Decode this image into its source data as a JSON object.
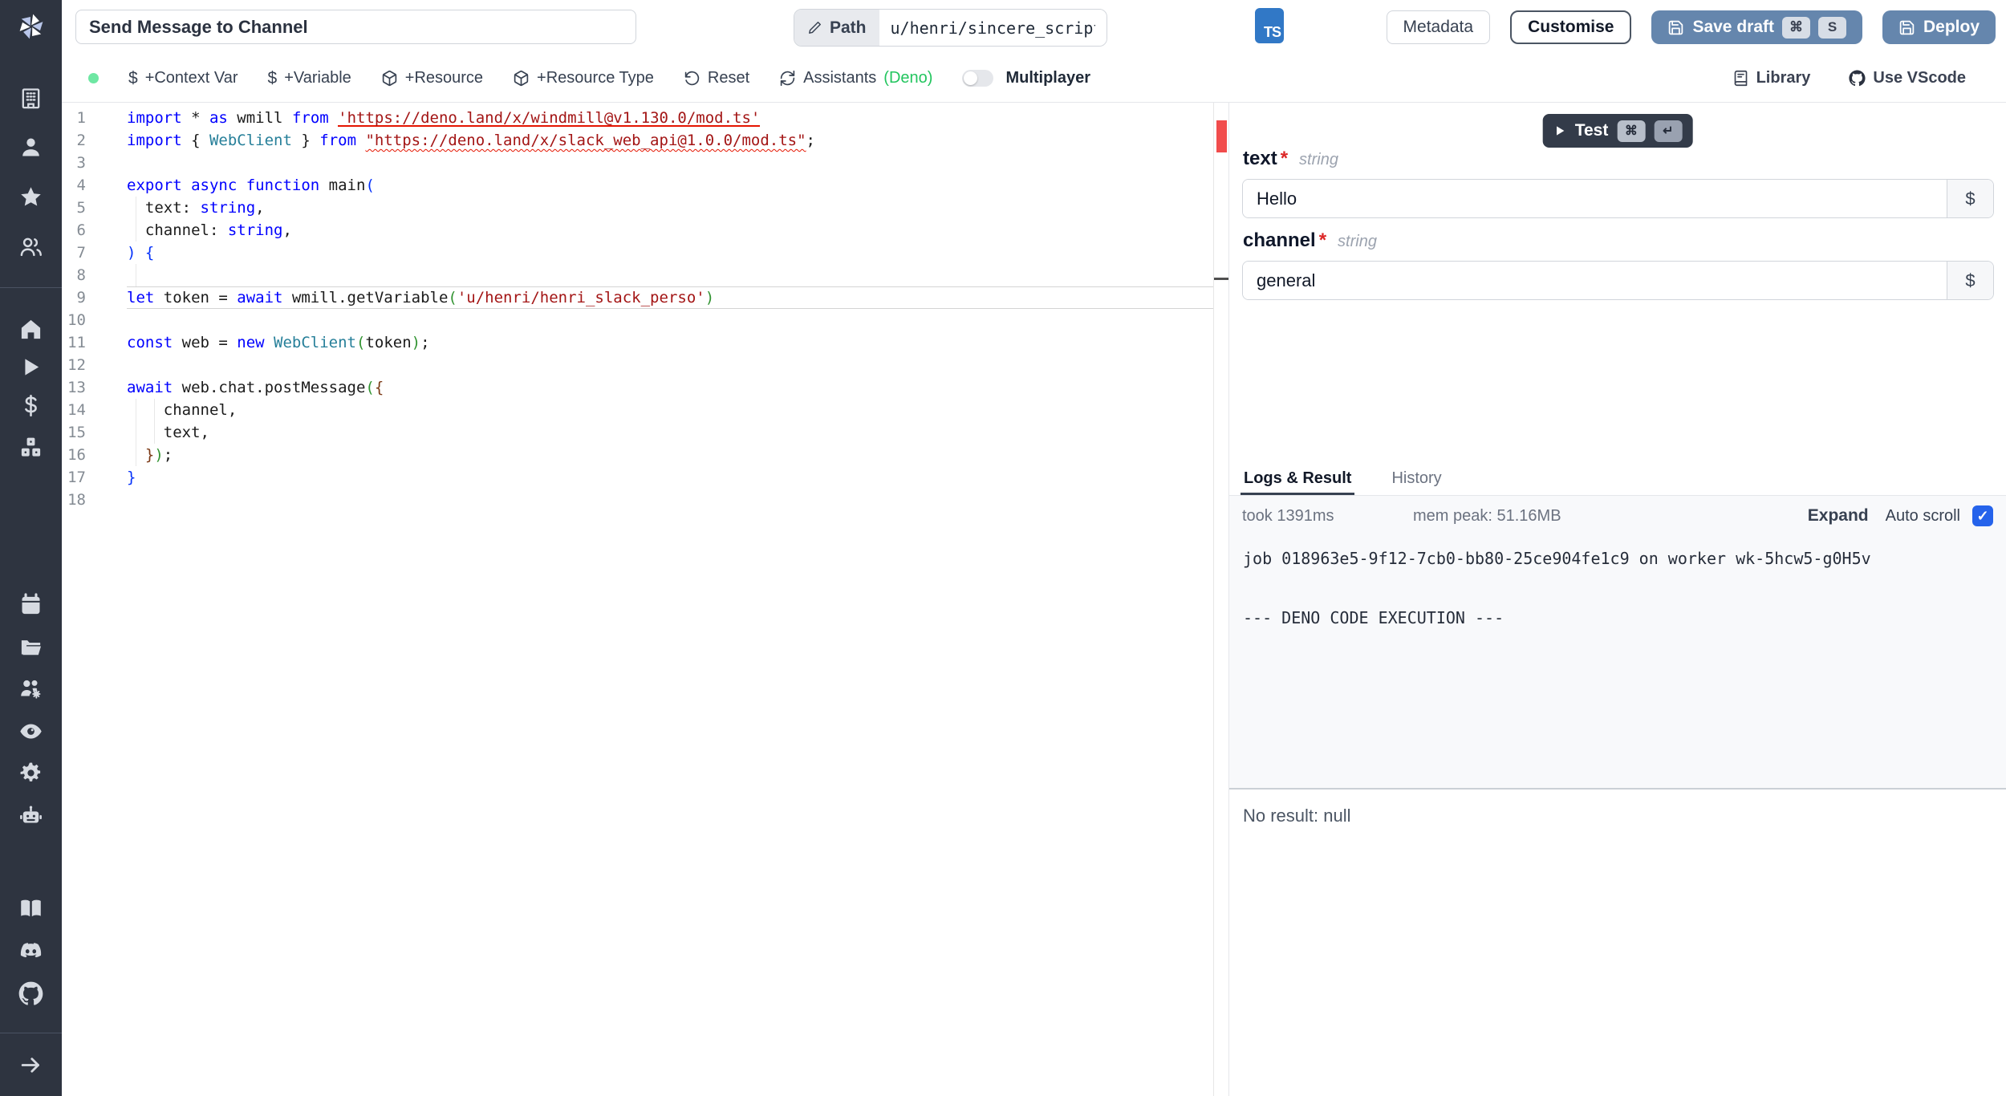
{
  "colors": {
    "sidebar_bg": "#2e3440",
    "primary_button": "#6586ad",
    "ts_badge": "#3178c6",
    "checkbox": "#2563eb",
    "deno_green": "#22c55e",
    "status_dot": "#6ee7a3",
    "error_red": "#e51400",
    "keyword_blue": "#0000ff",
    "string_red": "#a31515",
    "type_teal": "#267f99",
    "bracket_blue": "#0431fa",
    "bracket_green": "#319331",
    "bracket_brown": "#7b3814"
  },
  "topbar": {
    "title_value": "Send Message to Channel",
    "path_label": "Path",
    "path_value": "u/henri/sincere_script",
    "lang_badge": "TS",
    "metadata_label": "Metadata",
    "customise_label": "Customise",
    "save_draft_label": "Save draft",
    "save_draft_keys": [
      "⌘",
      "S"
    ],
    "deploy_label": "Deploy"
  },
  "toolbar": {
    "dollar_glyph": "$",
    "context_var_label": "+Context Var",
    "variable_label": "+Variable",
    "resource_label": "+Resource",
    "resource_type_label": "+Resource Type",
    "reset_label": "Reset",
    "assistants_label": "Assistants",
    "assistants_lang": "(Deno)",
    "multiplayer_label": "Multiplayer",
    "library_label": "Library",
    "vscode_label": "Use VScode"
  },
  "sidebar": {
    "icons": [
      "building-icon",
      "user-icon",
      "star-icon",
      "users-icon",
      "home-icon",
      "play-icon",
      "dollar-icon",
      "boxes-icon",
      "calendar-icon",
      "folder-open-icon",
      "workers-icon",
      "eye-icon",
      "settings-gear-icon",
      "robot-icon",
      "book-open-icon",
      "discord-icon",
      "github-icon",
      "arrow-right-icon"
    ]
  },
  "editor": {
    "language": "typescript",
    "current_line": 9,
    "lines": [
      [
        [
          "k",
          "import "
        ],
        [
          "d",
          "* "
        ],
        [
          "k",
          "as "
        ],
        [
          "d",
          "wmill "
        ],
        [
          "k",
          "from "
        ],
        [
          "su",
          "'https://deno.land/x/windmill@v1.130.0/mod.ts'"
        ]
      ],
      [
        [
          "k",
          "import "
        ],
        [
          "d",
          "{ "
        ],
        [
          "t",
          "WebClient"
        ],
        [
          "d",
          " } "
        ],
        [
          "k",
          "from "
        ],
        [
          "sw",
          "\"https://deno.land/x/slack_web_api@1.0.0/mod.ts\""
        ],
        [
          "d",
          ";"
        ]
      ],
      [],
      [
        [
          "k",
          "export async function "
        ],
        [
          "d",
          "main"
        ],
        [
          "b1",
          "("
        ]
      ],
      [
        [
          "d",
          "  text: "
        ],
        [
          "k",
          "string"
        ],
        [
          "d",
          ","
        ]
      ],
      [
        [
          "d",
          "  channel: "
        ],
        [
          "k",
          "string"
        ],
        [
          "d",
          ","
        ]
      ],
      [
        [
          "b1",
          ") {"
        ]
      ],
      [],
      [
        [
          "k",
          "let "
        ],
        [
          "d",
          "token = "
        ],
        [
          "k",
          "await "
        ],
        [
          "d",
          "wmill.getVariable"
        ],
        [
          "b2",
          "("
        ],
        [
          "s",
          "'u/henri/henri_slack_perso'"
        ],
        [
          "b2",
          ")"
        ]
      ],
      [],
      [
        [
          "k",
          "const "
        ],
        [
          "d",
          "web = "
        ],
        [
          "k",
          "new "
        ],
        [
          "t",
          "WebClient"
        ],
        [
          "b2",
          "("
        ],
        [
          "d",
          "token"
        ],
        [
          "b2",
          ")"
        ],
        [
          "d",
          ";"
        ]
      ],
      [],
      [
        [
          "k",
          "await "
        ],
        [
          "d",
          "web.chat.postMessage"
        ],
        [
          "b2",
          "("
        ],
        [
          "b3",
          "{"
        ]
      ],
      [
        [
          "d",
          "    channel,"
        ]
      ],
      [
        [
          "d",
          "    text,"
        ]
      ],
      [
        [
          "d",
          "  "
        ],
        [
          "b3",
          "}"
        ],
        [
          "b2",
          ")"
        ],
        [
          "d",
          ";"
        ]
      ],
      [
        [
          "b1",
          "}"
        ]
      ],
      []
    ]
  },
  "form": {
    "test_label": "Test",
    "test_keys": [
      "⌘",
      "↵"
    ],
    "dollar_label": "$",
    "fields": [
      {
        "name": "text",
        "required": "*",
        "type": "string",
        "value": "Hello"
      },
      {
        "name": "channel",
        "required": "*",
        "type": "string",
        "value": "general"
      }
    ]
  },
  "results": {
    "tabs": [
      "Logs & Result",
      "History"
    ],
    "took": "took 1391ms",
    "mem": "mem peak: 51.16MB",
    "expand_label": "Expand",
    "autoscroll_label": "Auto scroll",
    "log_lines": [
      "job 018963e5-9f12-7cb0-bb80-25ce904fe1c9 on worker wk-5hcw5-g0H5v",
      "",
      "--- DENO CODE EXECUTION ---"
    ],
    "no_result": "No result: null"
  }
}
